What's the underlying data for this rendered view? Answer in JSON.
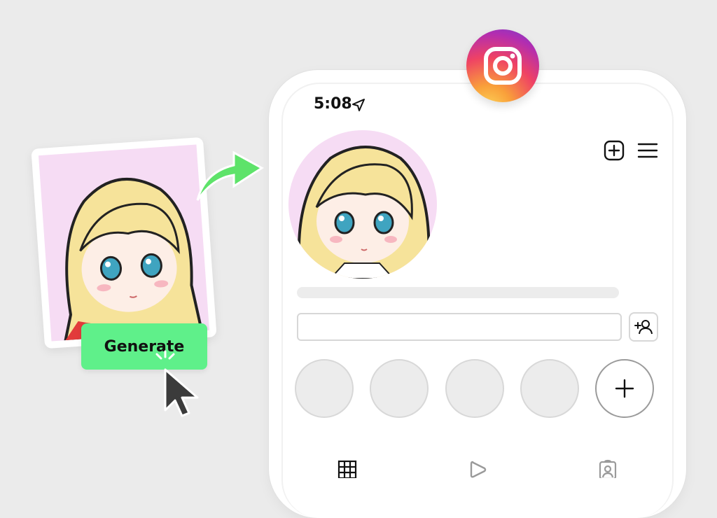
{
  "promo": {
    "generate_label": "Generate"
  },
  "status_bar": {
    "time": "5:08",
    "location_icon": "location-arrow-icon"
  },
  "profile": {
    "header_icons": [
      "new-post-icon",
      "menu-icon"
    ],
    "add_person_icon": "add-person-icon",
    "highlights": [
      {
        "kind": "empty"
      },
      {
        "kind": "empty"
      },
      {
        "kind": "empty"
      },
      {
        "kind": "empty"
      },
      {
        "kind": "new",
        "icon": "plus-icon"
      }
    ],
    "tabs": [
      {
        "name": "grid",
        "icon": "grid-icon"
      },
      {
        "name": "reels",
        "icon": "play-icon"
      },
      {
        "name": "tagged",
        "icon": "tagged-person-icon"
      }
    ]
  },
  "colors": {
    "background": "#ebebeb",
    "generate_button": "#5ff08a",
    "arrow_green": "#5ee36a",
    "avatar_bg": "#f6dcf4"
  }
}
